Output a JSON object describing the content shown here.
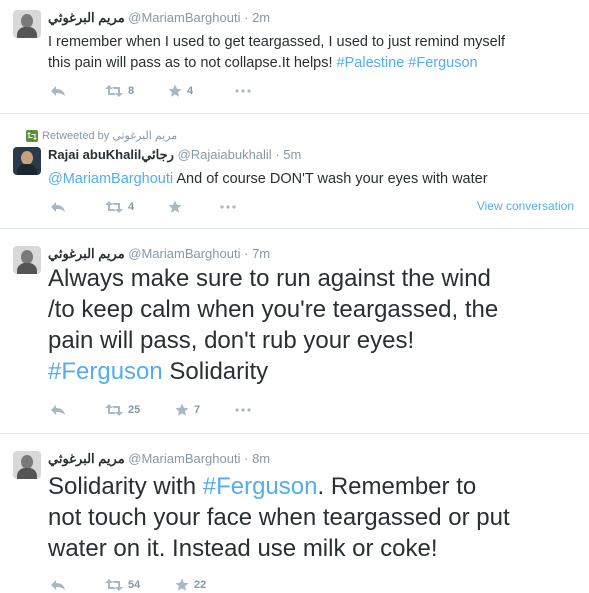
{
  "tweets": [
    {
      "name": "مريم البرغوثي",
      "handle": "@MariamBarghouti",
      "time": "2m",
      "text_plain": "I remember when I used to get teargassed, I used to just remind myself\nthis pain will pass as to not collapse.It helps! ",
      "hashtag1": "#Palestine",
      "hashtag2": "#Ferguson",
      "retweets": "8",
      "favorites": "4"
    },
    {
      "retweeted_by": "Retweeted by",
      "retweeter": "مريم البرغوثي",
      "name": "Rajai abuKhalilرجائي",
      "handle": "@Rajaiabukhalil",
      "time": "5m",
      "mention": "@MariamBarghouti",
      "text_plain": " And of course DON'T wash your eyes with water",
      "retweets": "4",
      "view_conversation": "View conversation"
    },
    {
      "name": "مريم البرغوثي",
      "handle": "@MariamBarghouti",
      "time": "7m",
      "text_plain": "Always make sure to run against the wind\n/to keep calm when you're teargassed, the\npain will pass, don't rub your eyes!\n",
      "hashtag": "#Ferguson",
      "text_tail": " Solidarity",
      "retweets": "25",
      "favorites": "7"
    },
    {
      "name": "مريم البرغوثي",
      "handle": "@MariamBarghouti",
      "time": "8m",
      "text_head": "Solidarity with ",
      "hashtag": "#Ferguson",
      "text_tail": ". Remember to\nnot touch your face when teargassed or put\nwater on it. Instead use milk or coke!",
      "retweets": "54",
      "favorites": "22"
    }
  ],
  "separator": "·",
  "icons": {
    "reply": "reply-icon",
    "retweet": "retweet-icon",
    "favorite": "star-icon",
    "more": "more-icon"
  },
  "colors": {
    "link": "#55acee",
    "muted": "#8899a6",
    "text": "#292f33",
    "retweet_badge": "#5c913b"
  }
}
